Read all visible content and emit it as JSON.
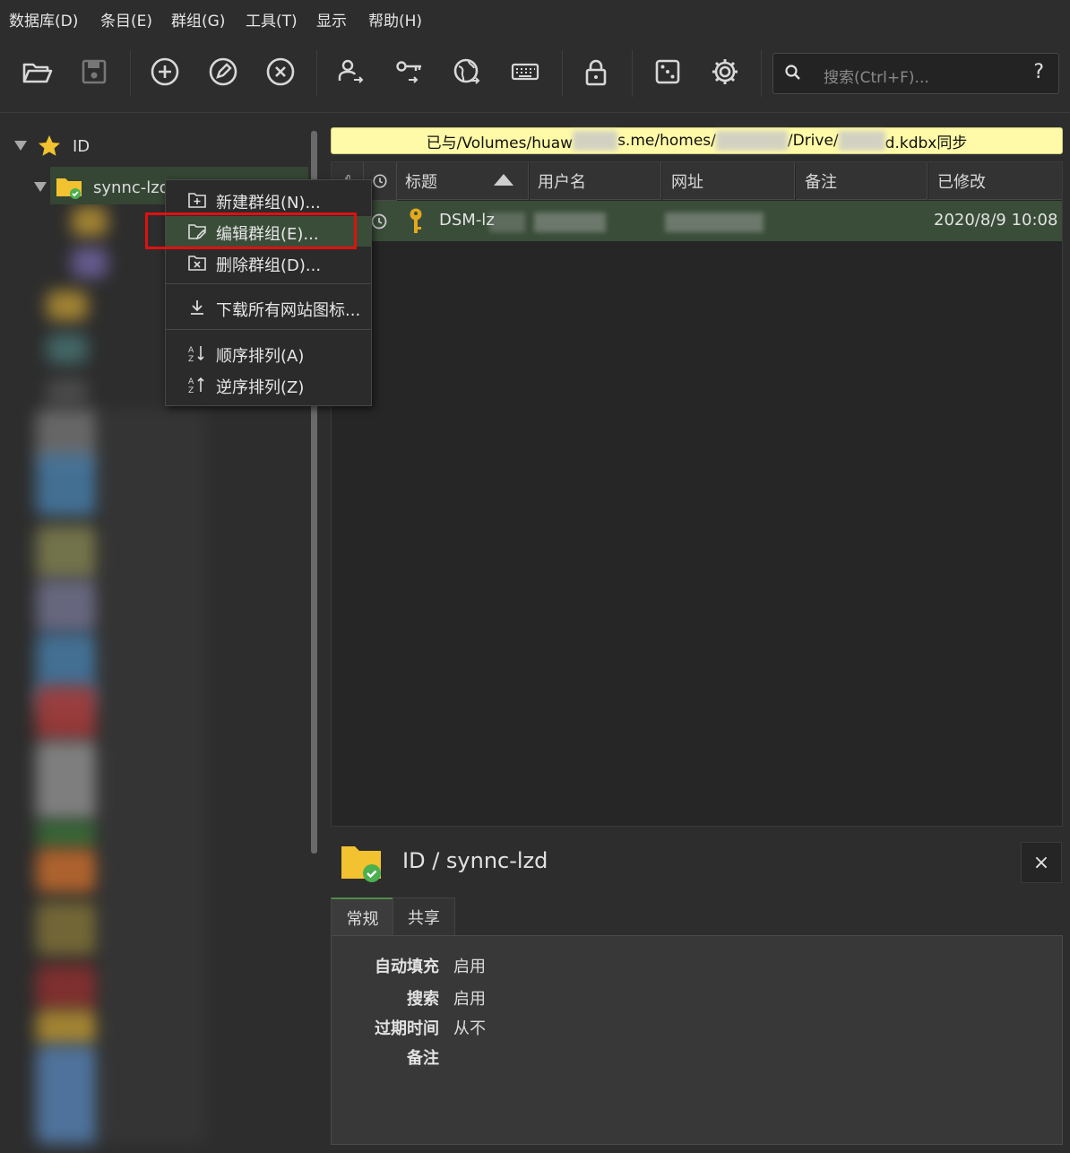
{
  "menubar": {
    "items": [
      "数据库(D)",
      "条目(E)",
      "群组(G)",
      "工具(T)",
      "显示",
      "帮助(H)"
    ]
  },
  "toolbar": {
    "icons": [
      "open-folder-icon",
      "save-icon",
      "add-entry-icon",
      "edit-entry-icon",
      "delete-entry-icon",
      "copy-username-icon",
      "copy-password-icon",
      "open-url-icon",
      "autotype-keyboard-icon",
      "lock-icon",
      "password-generator-dice-icon",
      "settings-gear-icon"
    ],
    "search_placeholder": "搜索(Ctrl+F)...",
    "search_help": "?"
  },
  "tree": {
    "root_label": "ID",
    "group_label": "synnc-lzd"
  },
  "status": {
    "part1": "已与/Volumes/huaw",
    "part2": "s.me/homes/",
    "part3": "/Drive/",
    "part4": "d.kdbx同步"
  },
  "table": {
    "headers": [
      "标题",
      "用户名",
      "网址",
      "备注",
      "已修改"
    ],
    "rows": [
      {
        "title": "DSM-lz",
        "username": "",
        "url": "",
        "notes": "",
        "modified": "2020/8/9 10:08"
      }
    ]
  },
  "context_menu": {
    "items": [
      "新建群组(N)...",
      "编辑群组(E)...",
      "删除群组(D)...",
      "下载所有网站图标...",
      "顺序排列(A)",
      "逆序排列(Z)"
    ]
  },
  "details": {
    "title": "ID / synnc-lzd",
    "close": "×",
    "tabs": [
      "常规",
      "共享"
    ],
    "props": [
      {
        "label": "自动填充",
        "value": "启用"
      },
      {
        "label": "搜索",
        "value": "启用"
      },
      {
        "label": "过期时间",
        "value": "从不"
      },
      {
        "label": "备注",
        "value": ""
      }
    ]
  },
  "colors": {
    "selection": "#3a4d39",
    "accent_green": "#4f8a4a",
    "status_bg": "#fffaa8",
    "highlight_box": "#e01010"
  }
}
